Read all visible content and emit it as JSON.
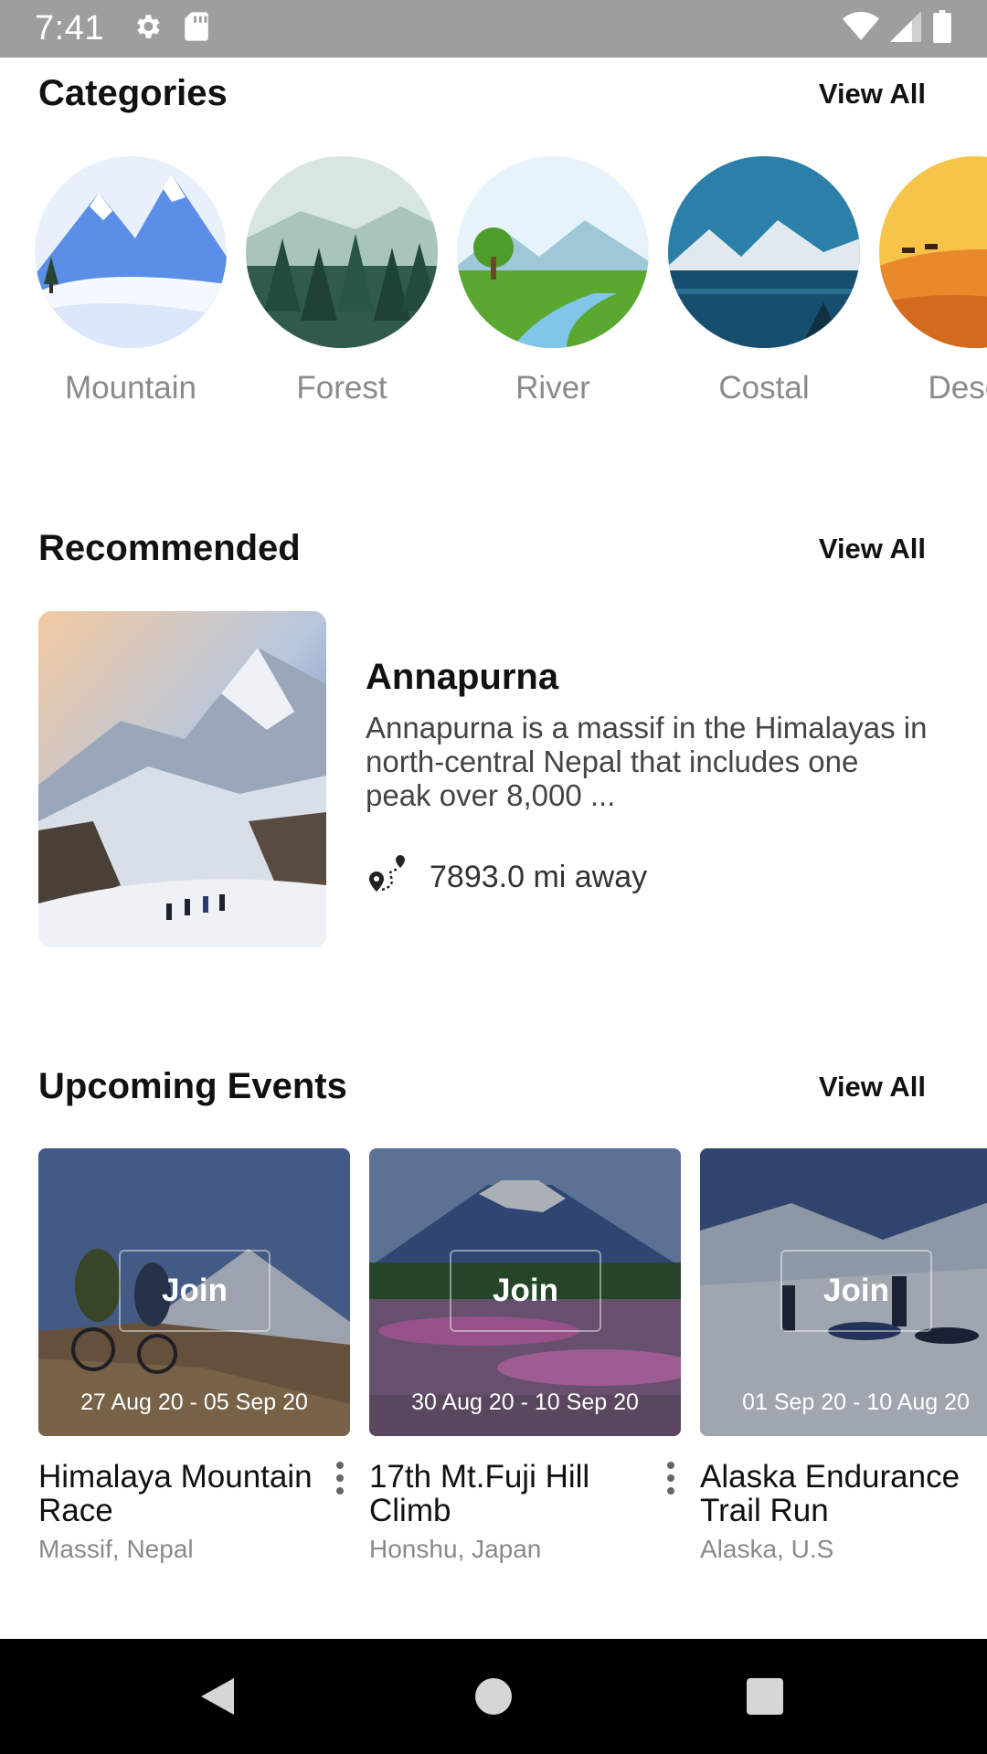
{
  "status_bar": {
    "time": "7:41",
    "icons": [
      "gear-icon",
      "sd-card-icon",
      "wifi-icon",
      "signal-icon",
      "battery-icon"
    ]
  },
  "categories": {
    "title": "Categories",
    "view_all": "View All",
    "items": [
      {
        "label": "Mountain",
        "icon": "mountain-illustration"
      },
      {
        "label": "Forest",
        "icon": "forest-illustration"
      },
      {
        "label": "River",
        "icon": "river-illustration"
      },
      {
        "label": "Costal",
        "icon": "coastal-illustration"
      },
      {
        "label": "Desert",
        "icon": "desert-illustration"
      }
    ]
  },
  "recommended": {
    "title": "Recommended",
    "view_all": "View All",
    "card": {
      "name": "Annapurna",
      "description": "Annapurna is a massif in the Himalayas in north-central Nepal that includes one peak over 8,000 ...",
      "distance": "7893.0 mi away",
      "distance_icon": "route-pin-icon"
    }
  },
  "events": {
    "title": "Upcoming Events",
    "view_all": "View All",
    "join_label": "Join",
    "items": [
      {
        "dates": "27 Aug 20 - 05 Sep 20",
        "title": "Himalaya Mountain Race",
        "location": "Massif, Nepal"
      },
      {
        "dates": "30 Aug 20 - 10 Sep 20",
        "title": "17th Mt.Fuji Hill Climb",
        "location": "Honshu, Japan"
      },
      {
        "dates": "01 Sep 20 - 10 Aug 20",
        "title": "Alaska Endurance Trail Run",
        "location": "Alaska, U.S"
      }
    ]
  },
  "nav_bar": {
    "buttons": [
      "back-icon",
      "home-icon",
      "recents-icon"
    ]
  }
}
